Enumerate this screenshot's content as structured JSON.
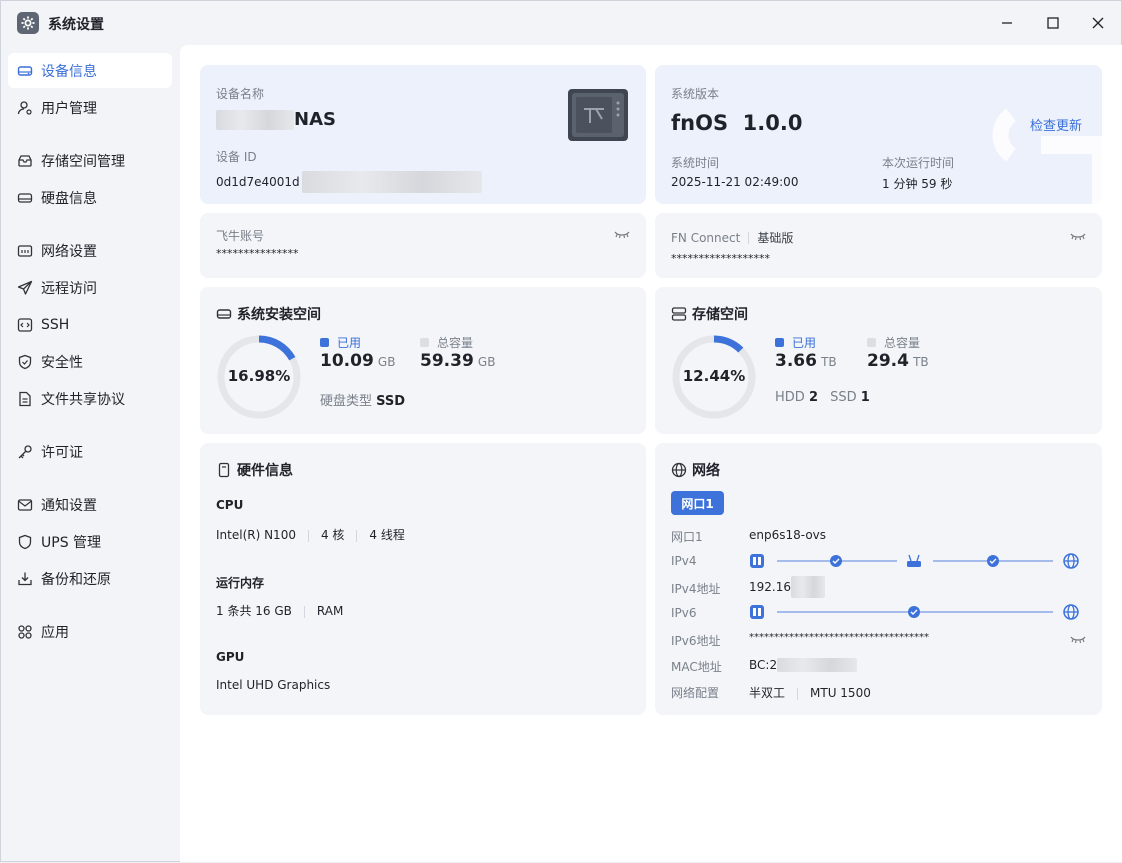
{
  "window": {
    "title": "系统设置"
  },
  "sidebar": {
    "items": [
      {
        "label": "设备信息",
        "icon": "hard-drive-icon"
      },
      {
        "label": "用户管理",
        "icon": "user-icon"
      },
      {
        "label": "存储空间管理",
        "icon": "storage-icon"
      },
      {
        "label": "硬盘信息",
        "icon": "disk-icon"
      },
      {
        "label": "网络设置",
        "icon": "network-icon"
      },
      {
        "label": "远程访问",
        "icon": "send-icon"
      },
      {
        "label": "SSH",
        "icon": "ssh-icon"
      },
      {
        "label": "安全性",
        "icon": "shield-check-icon"
      },
      {
        "label": "文件共享协议",
        "icon": "file-icon"
      },
      {
        "label": "许可证",
        "icon": "key-icon"
      },
      {
        "label": "通知设置",
        "icon": "mail-icon"
      },
      {
        "label": "UPS 管理",
        "icon": "shield-icon"
      },
      {
        "label": "备份和还原",
        "icon": "backup-icon"
      },
      {
        "label": "应用",
        "icon": "apps-icon"
      }
    ]
  },
  "device": {
    "name_label": "设备名称",
    "name_suffix": "NAS",
    "id_label": "设备 ID",
    "id_value": "0d1d7e4001d"
  },
  "system": {
    "version_label": "系统版本",
    "version_value": "fnOS  1.0.0",
    "check_update": "检查更新",
    "time_label": "系统时间",
    "time_value": "2025-11-21 02:49:00",
    "uptime_label": "本次运行时间",
    "uptime_value": "1 分钟 59 秒"
  },
  "account": {
    "label": "飞牛账号",
    "value": "***************"
  },
  "fnconnect": {
    "label": "FN Connect",
    "edition": "基础版",
    "value": "******************"
  },
  "install_space": {
    "title": "系统安装空间",
    "percent_text": "16.98%",
    "percent": 16.98,
    "used_label": "已用",
    "used_value": "10.09",
    "used_unit": "GB",
    "total_label": "总容量",
    "total_value": "59.39",
    "total_unit": "GB",
    "disk_type_label": "硬盘类型",
    "disk_type_value": "SSD"
  },
  "storage": {
    "title": "存储空间",
    "percent_text": "12.44%",
    "percent": 12.44,
    "used_label": "已用",
    "used_value": "3.66",
    "used_unit": "TB",
    "total_label": "总容量",
    "total_value": "29.4",
    "total_unit": "TB",
    "hdd_label": "HDD",
    "hdd_count": "2",
    "ssd_label": "SSD",
    "ssd_count": "1"
  },
  "hardware": {
    "title": "硬件信息",
    "cpu_label": "CPU",
    "cpu_model": "Intel(R) N100",
    "cpu_cores": "4 核",
    "cpu_threads": "4 线程",
    "ram_label": "运行内存",
    "ram_value": "1 条共 16 GB",
    "ram_type": "RAM",
    "gpu_label": "GPU",
    "gpu_value": "Intel UHD Graphics"
  },
  "network": {
    "title": "网络",
    "tab": "网口1",
    "port_label": "网口1",
    "port_value": "enp6s18-ovs",
    "ipv4_label": "IPv4",
    "ipv4_addr_label": "IPv4地址",
    "ipv4_addr_value": "192.16",
    "ipv6_label": "IPv6",
    "ipv6_addr_label": "IPv6地址",
    "ipv6_addr_value": "************************************",
    "mac_label": "MAC地址",
    "mac_value": "BC:2",
    "config_label": "网络配置",
    "duplex": "半双工",
    "mtu": "MTU 1500"
  },
  "colors": {
    "accent": "#3d72da",
    "ring_track": "#e4e6ea",
    "card_bg": "#f3f5f9",
    "card_blue_bg": "#edf1fb"
  }
}
